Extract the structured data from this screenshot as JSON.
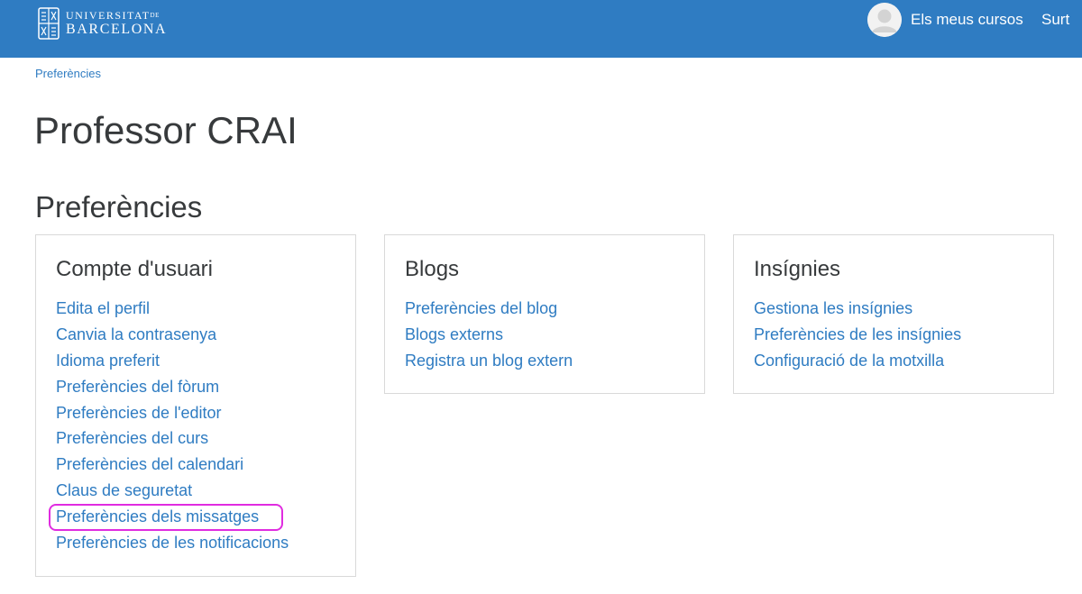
{
  "header": {
    "logo": {
      "line1": "UNIVERSITAT",
      "line1_small": "DE",
      "line2": "BARCELONA"
    },
    "my_courses": "Els meus cursos",
    "logout": "Surt"
  },
  "breadcrumb": "Preferències",
  "user_name": "Professor CRAI",
  "page_heading": "Preferències",
  "cards": {
    "account": {
      "title": "Compte d'usuari",
      "links": [
        "Edita el perfil",
        "Canvia la contrasenya",
        "Idioma preferit",
        "Preferències del fòrum",
        "Preferències de l'editor",
        "Preferències del curs",
        "Preferències del calendari",
        "Claus de seguretat",
        "Preferències dels missatges",
        "Preferències de les notificacions"
      ]
    },
    "blogs": {
      "title": "Blogs",
      "links": [
        "Preferències del blog",
        "Blogs externs",
        "Registra un blog extern"
      ]
    },
    "badges": {
      "title": "Insígnies",
      "links": [
        "Gestiona les insígnies",
        "Preferències de les insígnies",
        "Configuració de la motxilla"
      ]
    }
  },
  "colors": {
    "navbar": "#2f7cc2",
    "link": "#2f7cc2",
    "text": "#373a3c",
    "highlight": "#e02ce0"
  }
}
